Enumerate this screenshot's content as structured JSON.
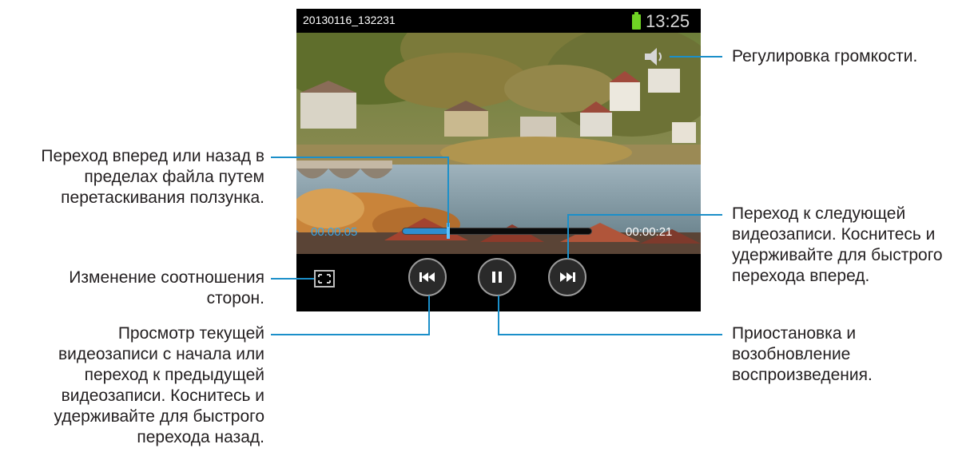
{
  "player": {
    "filename": "20130116_132231",
    "clock": "13:25",
    "time_current": "00:00:05",
    "time_total": "00:00:21",
    "progress_fraction": 0.24,
    "icons": {
      "battery": "battery-icon",
      "volume": "speaker-volume-icon",
      "aspect": "aspect-ratio-icon",
      "previous": "skip-previous-icon",
      "pause": "pause-icon",
      "next": "skip-next-icon"
    }
  },
  "callouts": {
    "volume": "Регулировка громкости.",
    "seek": [
      "Переход вперед или назад в",
      "пределах файла путем",
      "перетаскивания ползунка."
    ],
    "next": [
      "Переход к следующей",
      "видеозаписи. Коснитесь и",
      "удерживайте для быстрого",
      "перехода вперед."
    ],
    "aspect": [
      "Изменение соотношения",
      "сторон."
    ],
    "previous": [
      "Просмотр текущей",
      "видеозаписи с начала или",
      "переход к предыдущей",
      "видеозаписи. Коснитесь и",
      "удерживайте для быстрого",
      "перехода назад."
    ],
    "pause": [
      "Приостановка и",
      "возобновление",
      "воспроизведения."
    ]
  },
  "colors": {
    "leader": "#1b8fc9",
    "progress": "#2f8fd0",
    "battery": "#6fd324"
  }
}
